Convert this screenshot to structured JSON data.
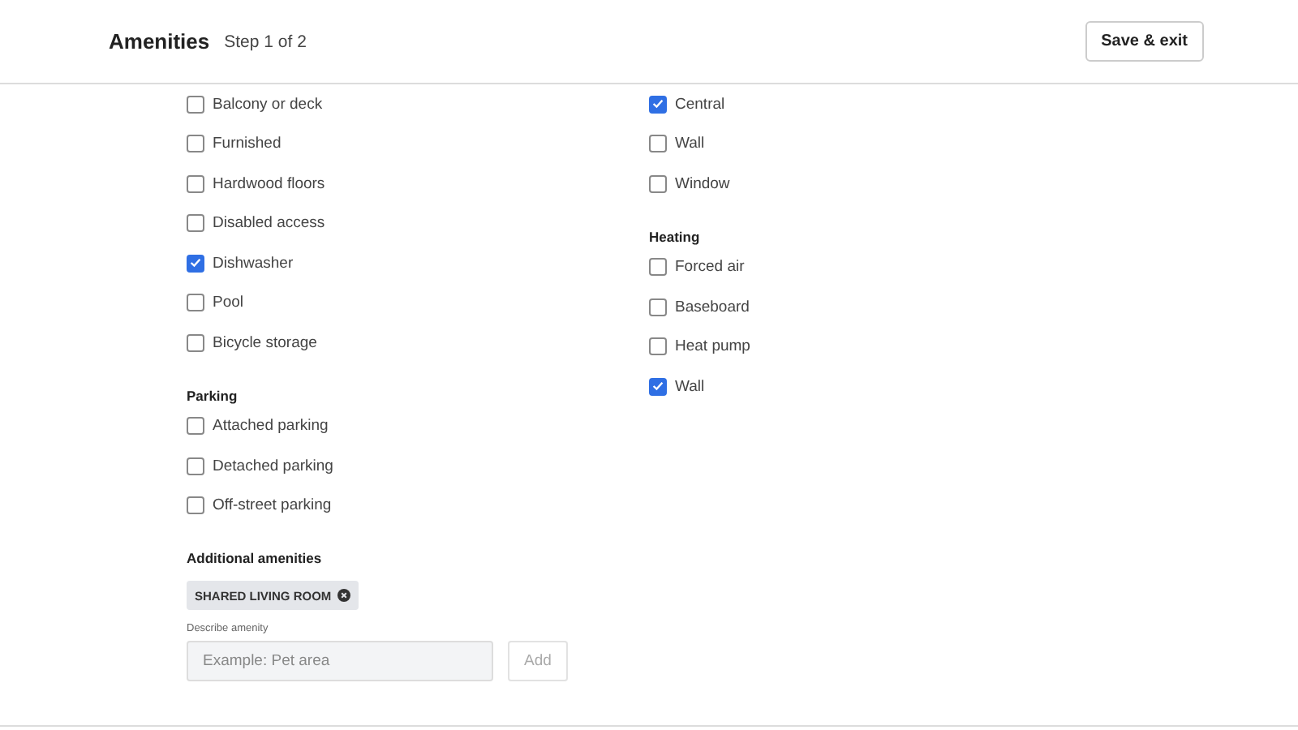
{
  "header": {
    "title": "Amenities",
    "step": "Step 1 of 2",
    "button": "Save & exit"
  },
  "columns": [
    [
      {
        "options": [
          {
            "label": "Balcony or deck",
            "checked": false
          },
          {
            "label": "Furnished",
            "checked": false
          },
          {
            "label": "Hardwood floors",
            "checked": false
          },
          {
            "label": "Disabled access",
            "checked": false
          },
          {
            "label": "Dishwasher",
            "checked": true
          },
          {
            "label": "Pool",
            "checked": false
          },
          {
            "label": "Bicycle storage",
            "checked": false
          }
        ]
      },
      {
        "heading": "Parking",
        "options": [
          {
            "label": "Attached parking",
            "checked": false
          },
          {
            "label": "Detached parking",
            "checked": false
          },
          {
            "label": "Off-street parking",
            "checked": false
          }
        ]
      }
    ],
    [
      {
        "options": [
          {
            "label": "Central",
            "checked": true
          },
          {
            "label": "Wall",
            "checked": false
          },
          {
            "label": "Window",
            "checked": false
          }
        ]
      },
      {
        "heading": "Heating",
        "options": [
          {
            "label": "Forced air",
            "checked": false
          },
          {
            "label": "Baseboard",
            "checked": false
          },
          {
            "label": "Heat pump",
            "checked": false
          },
          {
            "label": "Wall",
            "checked": true
          }
        ]
      }
    ]
  ],
  "additional": {
    "heading": "Additional amenities",
    "chips": [
      {
        "label": "SHARED LIVING ROOM"
      }
    ],
    "field_label": "Describe amenity",
    "placeholder": "Example: Pet area",
    "button": "Add"
  }
}
